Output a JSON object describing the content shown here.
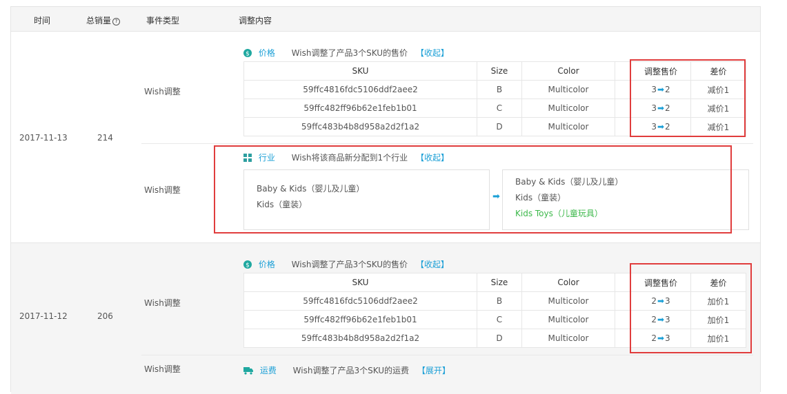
{
  "header": {
    "time": "时间",
    "total_sales": "总销量",
    "help_glyph": "?",
    "event_type": "事件类型",
    "adjustment": "调整内容"
  },
  "groups": [
    {
      "date": "2017-11-13",
      "sales": "214",
      "events": [
        {
          "type": "Wish调整",
          "category": "价格",
          "desc": "Wish调整了产品3个SKU的售价",
          "toggle": "【收起】",
          "columns": [
            "SKU",
            "Size",
            "Color",
            "",
            "调整售价",
            "差价"
          ],
          "rows": [
            {
              "sku": "59ffc4816fdc5106ddf2aee2",
              "size": "B",
              "color": "Multicolor",
              "from": "3",
              "to": "2",
              "diff": "减价1"
            },
            {
              "sku": "59ffc482ff96b62e1feb1b01",
              "size": "C",
              "color": "Multicolor",
              "from": "3",
              "to": "2",
              "diff": "减价1"
            },
            {
              "sku": "59ffc483b4b8d958a2d2f1a2",
              "size": "D",
              "color": "Multicolor",
              "from": "3",
              "to": "2",
              "diff": "减价1"
            }
          ]
        },
        {
          "type": "Wish调整",
          "category": "行业",
          "desc": "Wish将该商品新分配到1个行业",
          "toggle": "【收起】",
          "old_categories": [
            "Baby & Kids（婴儿及儿童）",
            "Kids（童装）"
          ],
          "new_categories": [
            "Baby & Kids（婴儿及儿童）",
            "Kids（童装）"
          ],
          "new_added": "Kids Toys（儿童玩具）"
        }
      ]
    },
    {
      "date": "2017-11-12",
      "sales": "206",
      "events": [
        {
          "type": "Wish调整",
          "category": "价格",
          "desc": "Wish调整了产品3个SKU的售价",
          "toggle": "【收起】",
          "columns": [
            "SKU",
            "Size",
            "Color",
            "",
            "调整售价",
            "差价"
          ],
          "rows": [
            {
              "sku": "59ffc4816fdc5106ddf2aee2",
              "size": "B",
              "color": "Multicolor",
              "from": "2",
              "to": "3",
              "diff": "加价1"
            },
            {
              "sku": "59ffc482ff96b62e1feb1b01",
              "size": "C",
              "color": "Multicolor",
              "from": "2",
              "to": "3",
              "diff": "加价1"
            },
            {
              "sku": "59ffc483b4b8d958a2d2f1a2",
              "size": "D",
              "color": "Multicolor",
              "from": "2",
              "to": "3",
              "diff": "加价1"
            }
          ]
        },
        {
          "type": "Wish调整",
          "category": "运费",
          "desc": "Wish调整了产品3个SKU的运费",
          "toggle": "【展开】"
        }
      ]
    }
  ],
  "colors": {
    "accent": "#1a9fd6",
    "green": "#3cb84a",
    "highlight_box": "#e03c3c",
    "price_icon": "#1fa8a0",
    "industry_icon": "#2d9fa0"
  },
  "icons": {
    "price": "dollar-coin-icon",
    "industry": "grid-icon",
    "shipping": "truck-icon",
    "arrow": "right-arrow-icon"
  }
}
